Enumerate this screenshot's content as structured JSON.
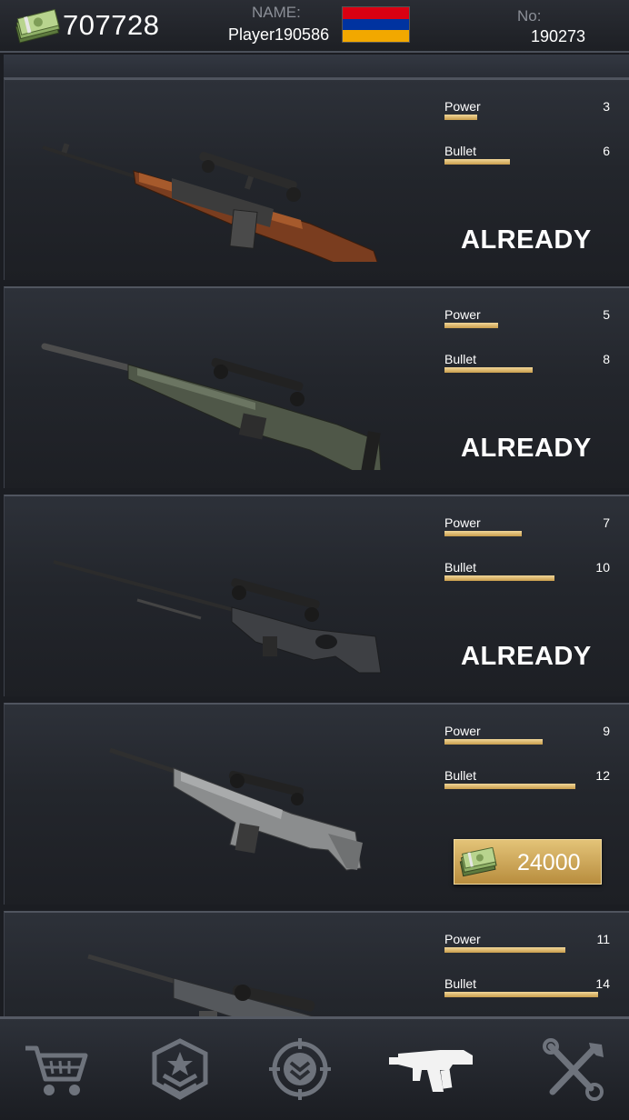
{
  "header": {
    "cash": "707728",
    "name_label": "NAME:",
    "player_name": "Player190586",
    "no_label": "No:",
    "player_no": "190273"
  },
  "weapons": [
    {
      "stats": [
        {
          "label": "Power",
          "value": "3",
          "fill": 0.2
        },
        {
          "label": "Bullet",
          "value": "6",
          "fill": 0.4
        }
      ],
      "status": "ALREADY"
    },
    {
      "stats": [
        {
          "label": "Power",
          "value": "5",
          "fill": 0.33
        },
        {
          "label": "Bullet",
          "value": "8",
          "fill": 0.54
        }
      ],
      "status": "ALREADY"
    },
    {
      "stats": [
        {
          "label": "Power",
          "value": "7",
          "fill": 0.47
        },
        {
          "label": "Bullet",
          "value": "10",
          "fill": 0.67
        }
      ],
      "status": "ALREADY"
    },
    {
      "stats": [
        {
          "label": "Power",
          "value": "9",
          "fill": 0.6
        },
        {
          "label": "Bullet",
          "value": "12",
          "fill": 0.8
        }
      ],
      "price": "24000"
    },
    {
      "stats": [
        {
          "label": "Power",
          "value": "11",
          "fill": 0.74
        },
        {
          "label": "Bullet",
          "value": "14",
          "fill": 0.94
        }
      ]
    }
  ],
  "nav": [
    "shop-cart-icon",
    "rank-badge-icon",
    "crosshair-icon",
    "weapon-gun-icon",
    "tools-icon"
  ],
  "colors": {
    "accent_gold": "#d9b461",
    "text": "#ffffff",
    "muted": "#8b8f97"
  }
}
